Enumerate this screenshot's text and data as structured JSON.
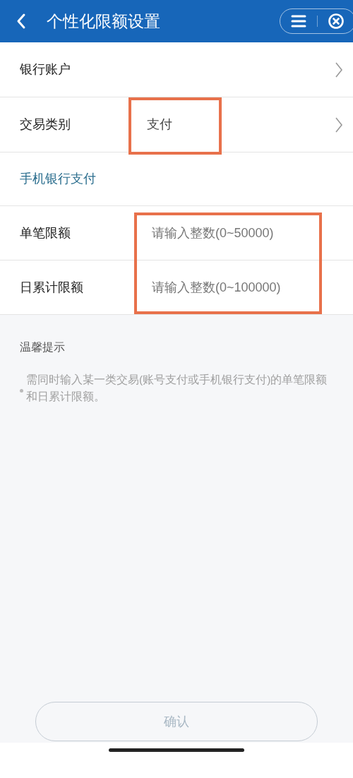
{
  "header": {
    "title": "个性化限额设置"
  },
  "rows": [
    {
      "kind": "nav",
      "label": "银行账户"
    },
    {
      "kind": "nav",
      "label": "交易类别",
      "value": "支付",
      "highlighted": true
    },
    {
      "kind": "section",
      "label": "手机银行支付"
    },
    {
      "kind": "input_group",
      "highlighted": true,
      "fields": [
        {
          "label": "单笔限额",
          "placeholder": "请输入整数(0~50000)"
        },
        {
          "label": "日累计限额",
          "placeholder": "请输入整数(0~100000)"
        }
      ]
    }
  ],
  "tips": {
    "title": "温馨提示",
    "items": [
      "需同时输入某一类交易(账号支付或手机银行支付)的单笔限额和日累计限额。"
    ]
  },
  "confirm_button": {
    "label": "确认",
    "disabled": true
  }
}
